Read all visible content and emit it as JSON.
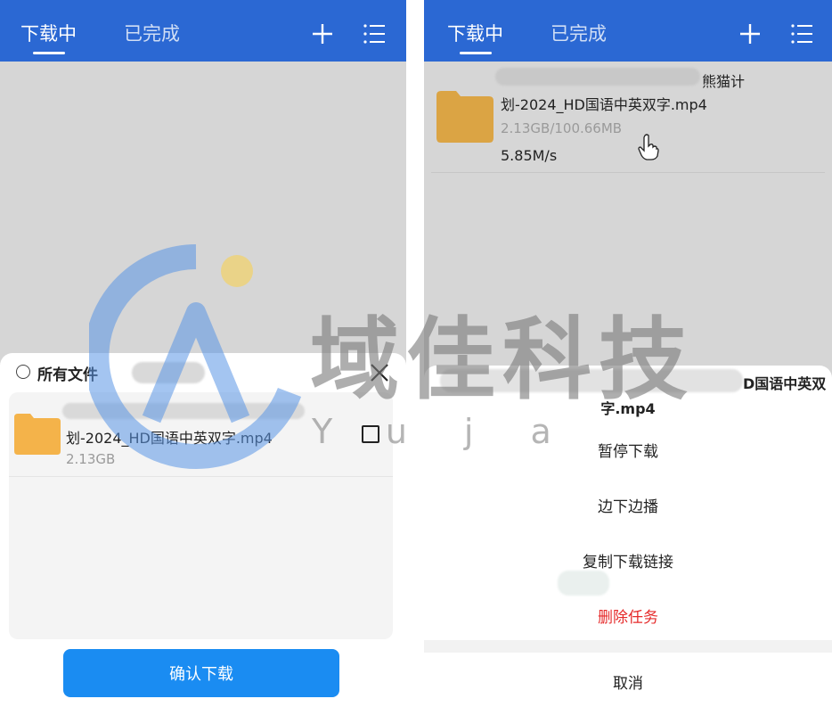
{
  "left": {
    "tabs": [
      {
        "label": "下载中"
      },
      {
        "label": "已完成"
      }
    ],
    "sheet": {
      "title": "所有文件",
      "file": {
        "name": "划-2024_HD国语中英双字.mp4",
        "size": "2.13GB"
      },
      "confirm_label": "确认下载"
    }
  },
  "right": {
    "tabs": [
      {
        "label": "下载中"
      },
      {
        "label": "已完成"
      }
    ],
    "task": {
      "name_line1": "熊猫计",
      "name_line2": "划-2024_HD国语中英双字.mp4",
      "progress": "2.13GB/100.66MB",
      "speed": "5.85M/s"
    },
    "action_sheet": {
      "title_line1": "D国语中英双",
      "title_line2": "字.mp4",
      "actions": [
        "暂停下载",
        "边下边播",
        "复制下载链接",
        "删除任务"
      ],
      "cancel_label": "取消"
    }
  },
  "watermark": {
    "cn": "域佳科技",
    "latin": "Yuja"
  },
  "colors": {
    "header": "#2b68d3",
    "primary_button": "#1a8cf2",
    "danger": "#e52a2a",
    "folder": "#f4b34a"
  }
}
